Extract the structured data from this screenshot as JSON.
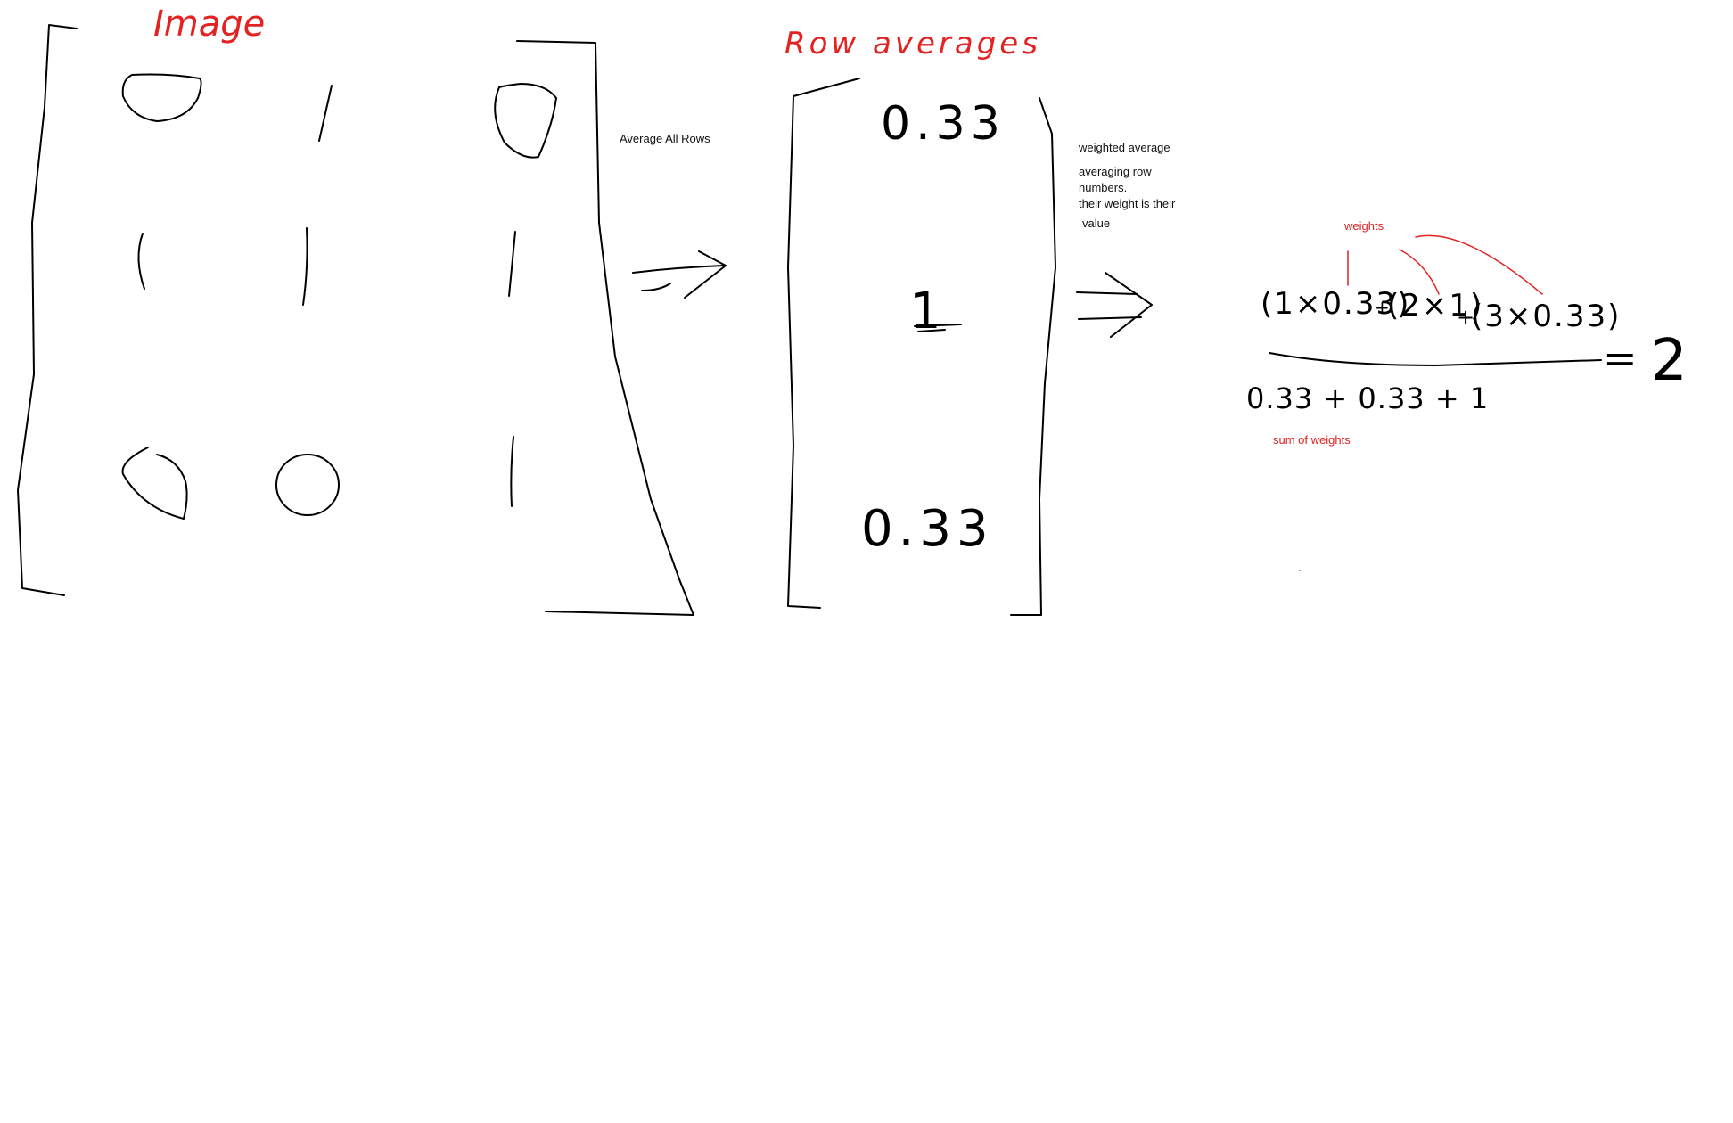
{
  "titles": {
    "image": "Image",
    "row_averages": "Row averages"
  },
  "labels": {
    "average_all_rows": "Average All Rows",
    "weighted_average": "weighted average",
    "averaging_line1": "averaging row",
    "averaging_line2": "numbers.",
    "averaging_line3": "their weight is their",
    "averaging_line4": "value",
    "weights": "weights",
    "sum_of_weights": "sum of weights"
  },
  "row_averages": {
    "row1": "0.33",
    "row2": "1",
    "row3": "0.33"
  },
  "formula": {
    "term1": "(1×0.33)",
    "plus1": "+",
    "term2": "(2×1)",
    "plus2": "+",
    "term3": "(3×0.33)",
    "denominator": "0.33 + 0.33 + 1",
    "equals": "=",
    "result": "2"
  },
  "colors": {
    "ink": "#000000",
    "annotation": "#e32222",
    "background": "#ffffff"
  }
}
